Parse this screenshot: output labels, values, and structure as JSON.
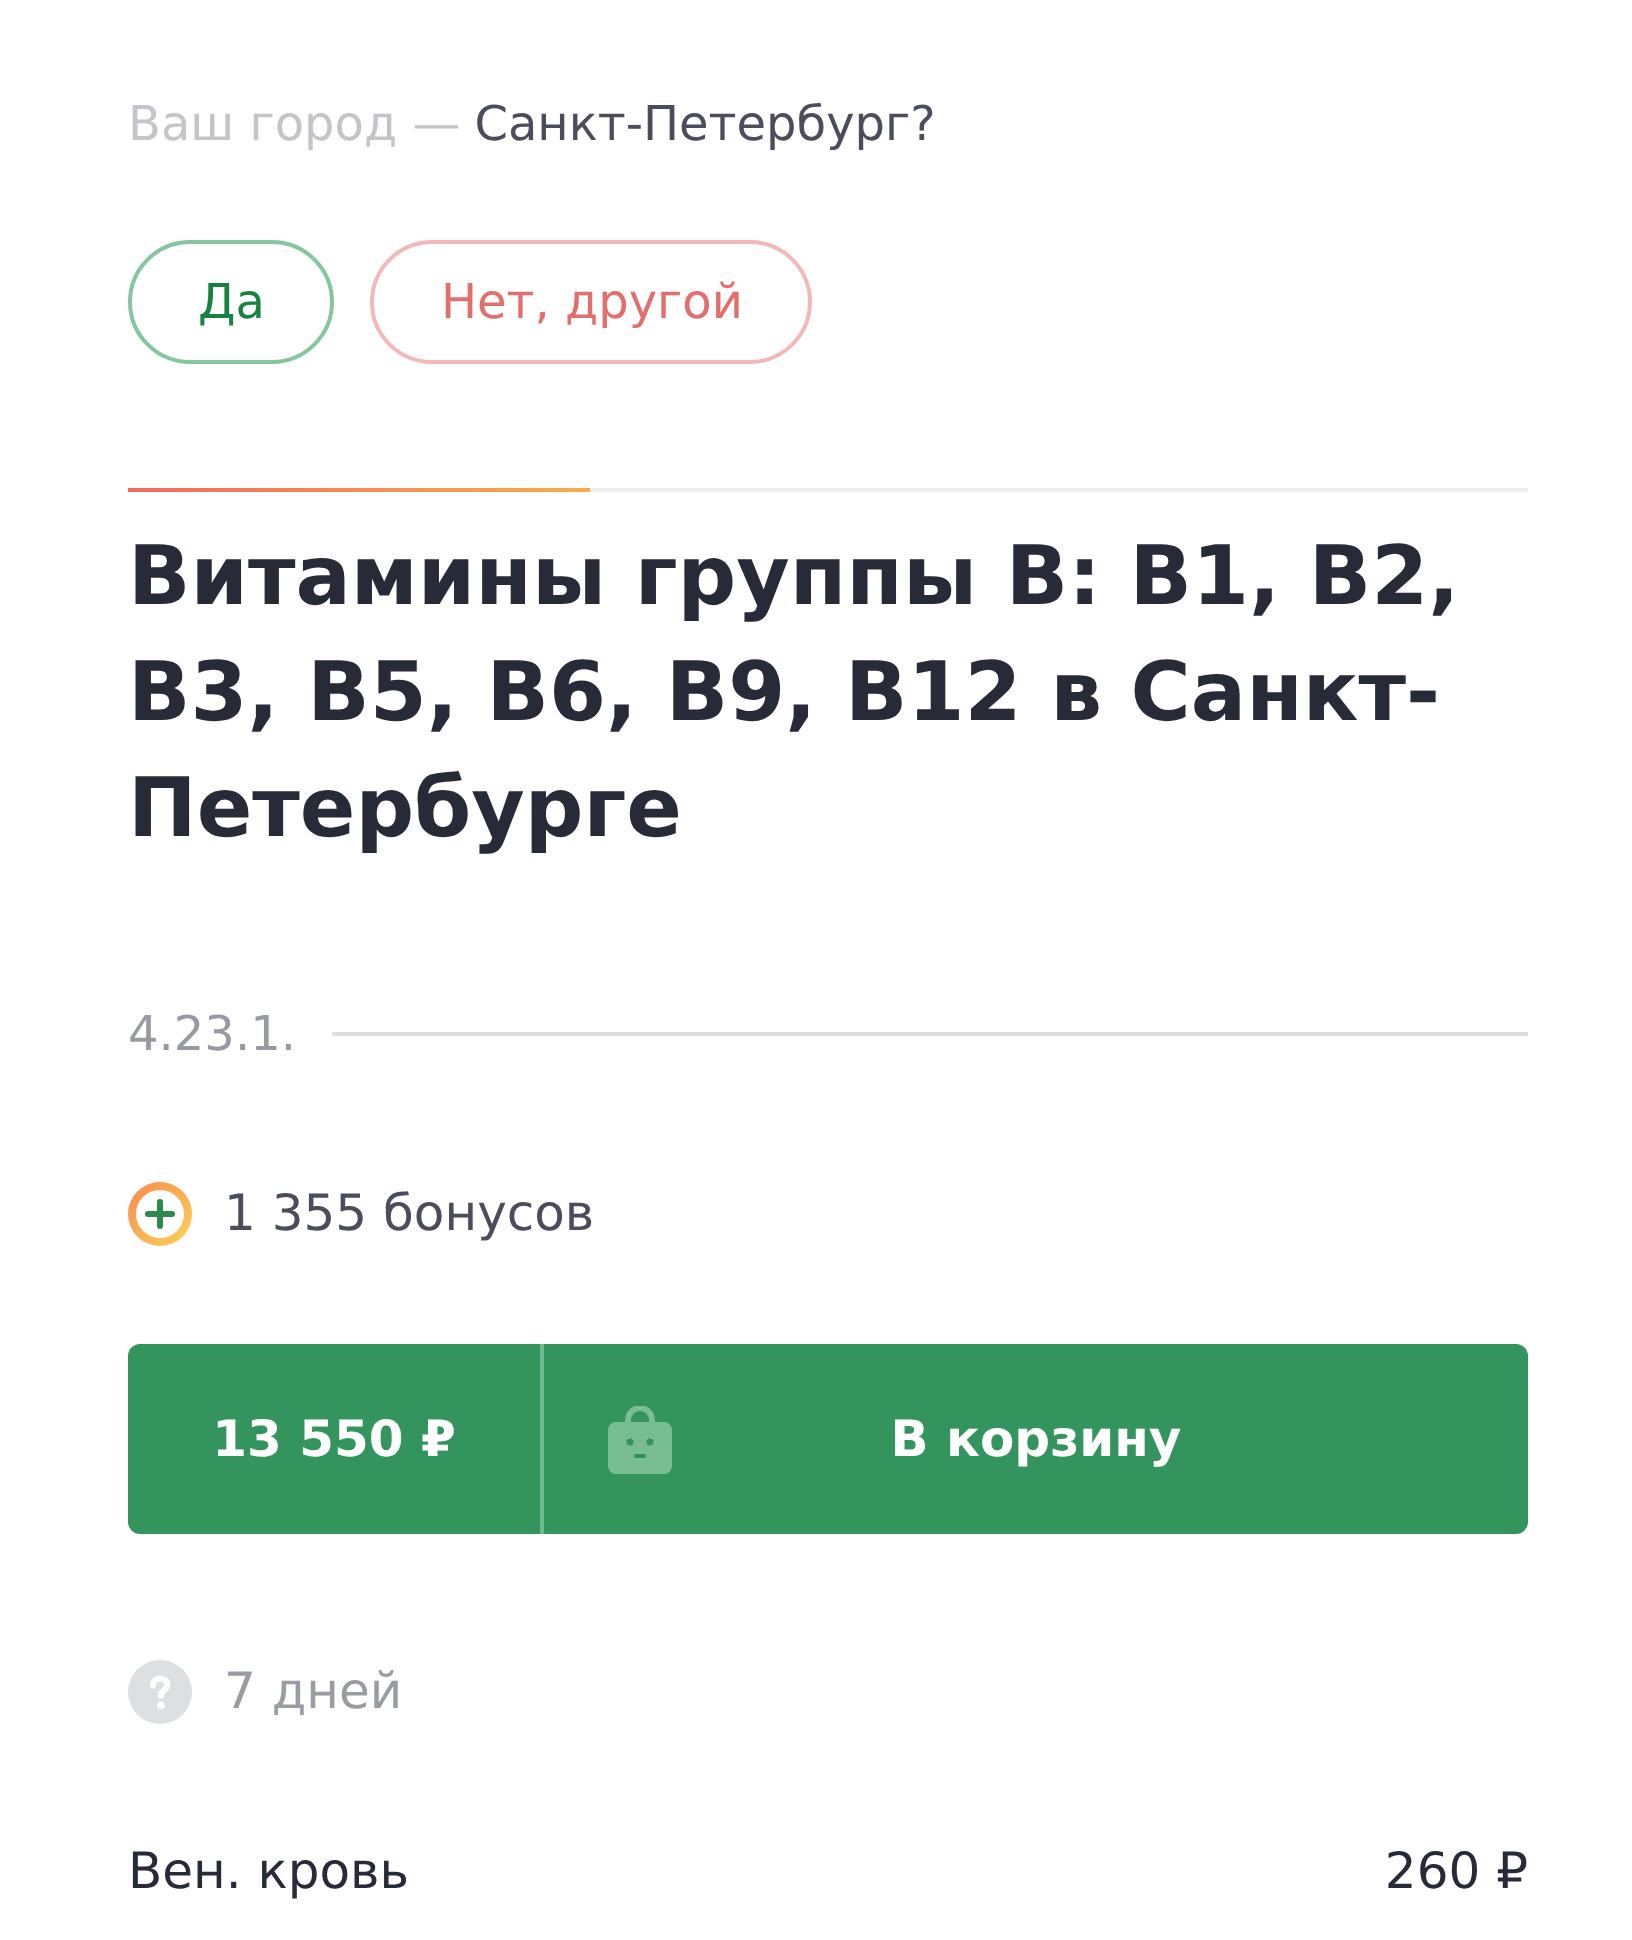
{
  "city_prompt": {
    "label": "Ваш город —",
    "city": "Санкт-Петербург?"
  },
  "city_buttons": [
    {
      "label": "Да",
      "kind": "confirm"
    },
    {
      "label": "Нет, другой",
      "kind": "decline"
    }
  ],
  "progress": {
    "level": 0.33
  },
  "product": {
    "title": "Витамины группы B: B1, B2, B3, B5, B6, B9, B12 в Санкт-Петербурге",
    "code": "4.23.1."
  },
  "bonus": {
    "text": "1 355 бонусов"
  },
  "purchase": {
    "price": "13 550 ₽",
    "button": "В корзину"
  },
  "duration": {
    "text": "7 дней"
  },
  "sample": {
    "name": "Вен. кровь",
    "price": "260 ₽"
  }
}
